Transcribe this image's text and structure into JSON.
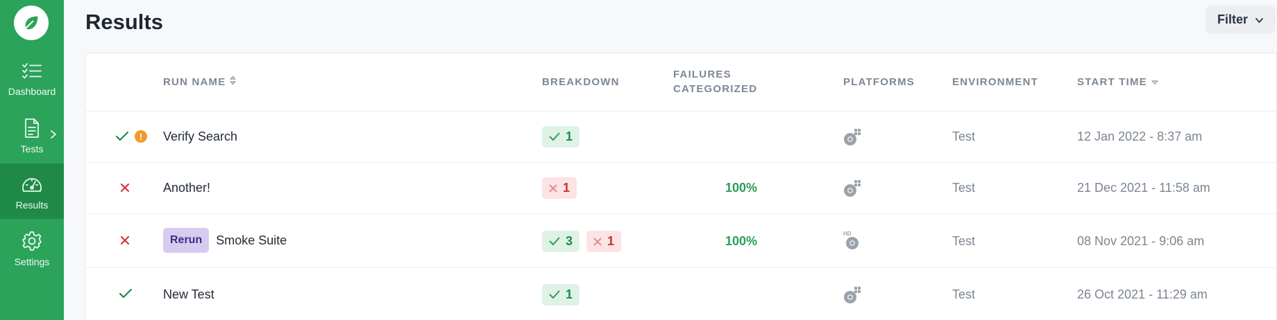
{
  "sidebar": {
    "items": [
      {
        "label": "Dashboard",
        "icon": "checklist-icon"
      },
      {
        "label": "Tests",
        "icon": "document-icon"
      },
      {
        "label": "Results",
        "icon": "gauge-icon"
      },
      {
        "label": "Settings",
        "icon": "gear-icon"
      }
    ],
    "active": "Results",
    "brand_color": "#2ba35b"
  },
  "header": {
    "title": "Results",
    "filter_label": "Filter"
  },
  "table": {
    "columns": {
      "run_name": "RUN NAME",
      "breakdown": "BREAKDOWN",
      "failures_line1": "FAILURES",
      "failures_line2": "CATEGORIZED",
      "platforms": "PLATFORMS",
      "environment": "ENVIRONMENT",
      "start_time": "START TIME"
    },
    "rows": [
      {
        "status": "passed-with-warning",
        "rerun": "",
        "name": "Verify Search",
        "pass_count": "1",
        "fail_count": "",
        "failures_categorized": "",
        "platform": "chrome-windows",
        "environment": "Test",
        "start_time": "12 Jan 2022 - 8:37 am"
      },
      {
        "status": "failed",
        "rerun": "",
        "name": "Another!",
        "pass_count": "",
        "fail_count": "1",
        "failures_categorized": "100%",
        "platform": "chrome-windows",
        "environment": "Test",
        "start_time": "21 Dec 2021 - 11:58 am"
      },
      {
        "status": "failed",
        "rerun": "Rerun",
        "name": "Smoke Suite",
        "pass_count": "3",
        "fail_count": "1",
        "failures_categorized": "100%",
        "platform": "chrome-hd",
        "platform_badge": "HD",
        "environment": "Test",
        "start_time": "08 Nov 2021 - 9:06 am"
      },
      {
        "status": "passed",
        "rerun": "",
        "name": "New Test",
        "pass_count": "1",
        "fail_count": "",
        "failures_categorized": "",
        "platform": "chrome-windows",
        "environment": "Test",
        "start_time": "26 Oct 2021 - 11:29 am"
      }
    ]
  },
  "colors": {
    "pass": "#1f8a48",
    "fail": "#d63338",
    "warning": "#f39a2c",
    "rerun": "#d6ccf0"
  }
}
